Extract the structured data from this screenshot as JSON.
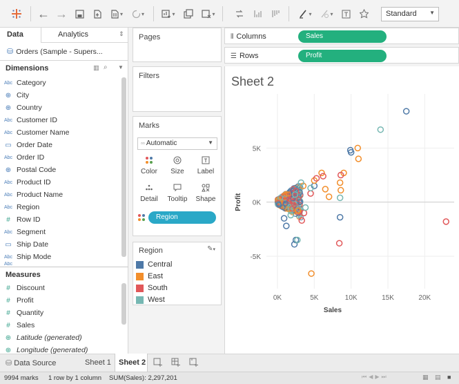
{
  "toolbar": {
    "icons": [
      "tableau-logo-icon",
      "back-icon",
      "forward-icon",
      "save-icon",
      "new-datasource-icon",
      "pause-icon",
      "refresh-icon",
      "new-sheet-icon",
      "duplicate-icon",
      "clear-icon",
      "swap-icon",
      "sort-asc-icon",
      "sort-desc-icon",
      "highlight-icon",
      "group-icon",
      "label-icon",
      "pin-icon"
    ],
    "fit_select": "Standard"
  },
  "data_pane": {
    "tabs": [
      "Data",
      "Analytics"
    ],
    "datasource": "Orders (Sample - Supers...",
    "dimensions_label": "Dimensions",
    "dimensions": [
      {
        "type": "abc",
        "name": "Category"
      },
      {
        "type": "globe",
        "name": "City"
      },
      {
        "type": "globe",
        "name": "Country"
      },
      {
        "type": "abc",
        "name": "Customer ID"
      },
      {
        "type": "abc",
        "name": "Customer Name"
      },
      {
        "type": "cal",
        "name": "Order Date"
      },
      {
        "type": "abc",
        "name": "Order ID"
      },
      {
        "type": "globe",
        "name": "Postal Code"
      },
      {
        "type": "abc",
        "name": "Product ID"
      },
      {
        "type": "abc",
        "name": "Product Name"
      },
      {
        "type": "abc",
        "name": "Region"
      },
      {
        "type": "hash",
        "name": "Row ID"
      },
      {
        "type": "abc",
        "name": "Segment"
      },
      {
        "type": "cal",
        "name": "Ship Date"
      },
      {
        "type": "abc",
        "name": "Ship Mode"
      }
    ],
    "measures_label": "Measures",
    "measures": [
      {
        "type": "hash",
        "name": "Discount"
      },
      {
        "type": "hash",
        "name": "Profit"
      },
      {
        "type": "hash",
        "name": "Quantity"
      },
      {
        "type": "hash",
        "name": "Sales"
      },
      {
        "type": "gglobe",
        "name": "Latitude (generated)"
      },
      {
        "type": "gglobe",
        "name": "Longitude (generated)"
      }
    ]
  },
  "cards": {
    "pages": "Pages",
    "filters": "Filters",
    "marks": "Marks",
    "mark_type": "Automatic",
    "mark_buttons": [
      "Color",
      "Size",
      "Label",
      "Detail",
      "Tooltip",
      "Shape"
    ],
    "region_pill": "Region",
    "legend_title": "Region",
    "legend": [
      {
        "name": "Central",
        "color": "#4e79a7"
      },
      {
        "name": "East",
        "color": "#f28e2b"
      },
      {
        "name": "South",
        "color": "#e15759"
      },
      {
        "name": "West",
        "color": "#76b7b2"
      }
    ]
  },
  "shelves": {
    "columns_label": "Columns",
    "columns_pill": "Sales",
    "rows_label": "Rows",
    "rows_pill": "Profit"
  },
  "view": {
    "title": "Sheet 2"
  },
  "chart_data": {
    "type": "scatter",
    "title": "Sheet 2",
    "xlabel": "Sales",
    "ylabel": "Profit",
    "xlim": [
      -1500,
      24000
    ],
    "ylim": [
      -8000,
      10000
    ],
    "x_ticks": [
      0,
      5000,
      10000,
      15000,
      20000
    ],
    "x_tick_labels": [
      "0K",
      "5K",
      "10K",
      "15K",
      "20K"
    ],
    "y_ticks": [
      -5000,
      0,
      5000
    ],
    "y_tick_labels": [
      "-5K",
      "0K",
      "5K"
    ],
    "grid": true,
    "series": [
      {
        "name": "Central",
        "color": "#4e79a7",
        "points": [
          [
            17500,
            8400
          ],
          [
            10000,
            4600
          ],
          [
            9900,
            4800
          ],
          [
            8500,
            -1400
          ],
          [
            2500,
            -3500
          ],
          [
            2300,
            -3900
          ],
          [
            1200,
            -2200
          ],
          [
            900,
            -1500
          ],
          [
            3000,
            900
          ],
          [
            5000,
            1500
          ]
        ]
      },
      {
        "name": "East",
        "color": "#f28e2b",
        "points": [
          [
            10900,
            5000
          ],
          [
            11000,
            4000
          ],
          [
            9000,
            2700
          ],
          [
            8500,
            1800
          ],
          [
            8600,
            1100
          ],
          [
            6000,
            2700
          ],
          [
            5000,
            2000
          ],
          [
            3500,
            1500
          ],
          [
            2800,
            -800
          ],
          [
            4600,
            -6600
          ],
          [
            7000,
            500
          ],
          [
            6500,
            1200
          ]
        ]
      },
      {
        "name": "South",
        "color": "#e15759",
        "points": [
          [
            22900,
            -1800
          ],
          [
            8400,
            -3800
          ],
          [
            8600,
            2500
          ],
          [
            6200,
            2400
          ],
          [
            3300,
            -1700
          ],
          [
            4500,
            800
          ],
          [
            2500,
            1000
          ],
          [
            5300,
            2200
          ],
          [
            3600,
            -1000
          ]
        ]
      },
      {
        "name": "West",
        "color": "#76b7b2",
        "points": [
          [
            14000,
            6700
          ],
          [
            8500,
            400
          ],
          [
            2700,
            -3500
          ],
          [
            3800,
            -500
          ],
          [
            4500,
            1300
          ],
          [
            2400,
            700
          ],
          [
            1800,
            -1200
          ],
          [
            3200,
            1800
          ]
        ]
      }
    ]
  },
  "sheet_tabs": {
    "data_source": "Data Source",
    "sheets": [
      "Sheet 1",
      "Sheet 2"
    ],
    "active": "Sheet 2"
  },
  "status": {
    "marks": "9994 marks",
    "rows": "1 row by 1 column",
    "sum": "SUM(Sales): 2,297,201"
  }
}
